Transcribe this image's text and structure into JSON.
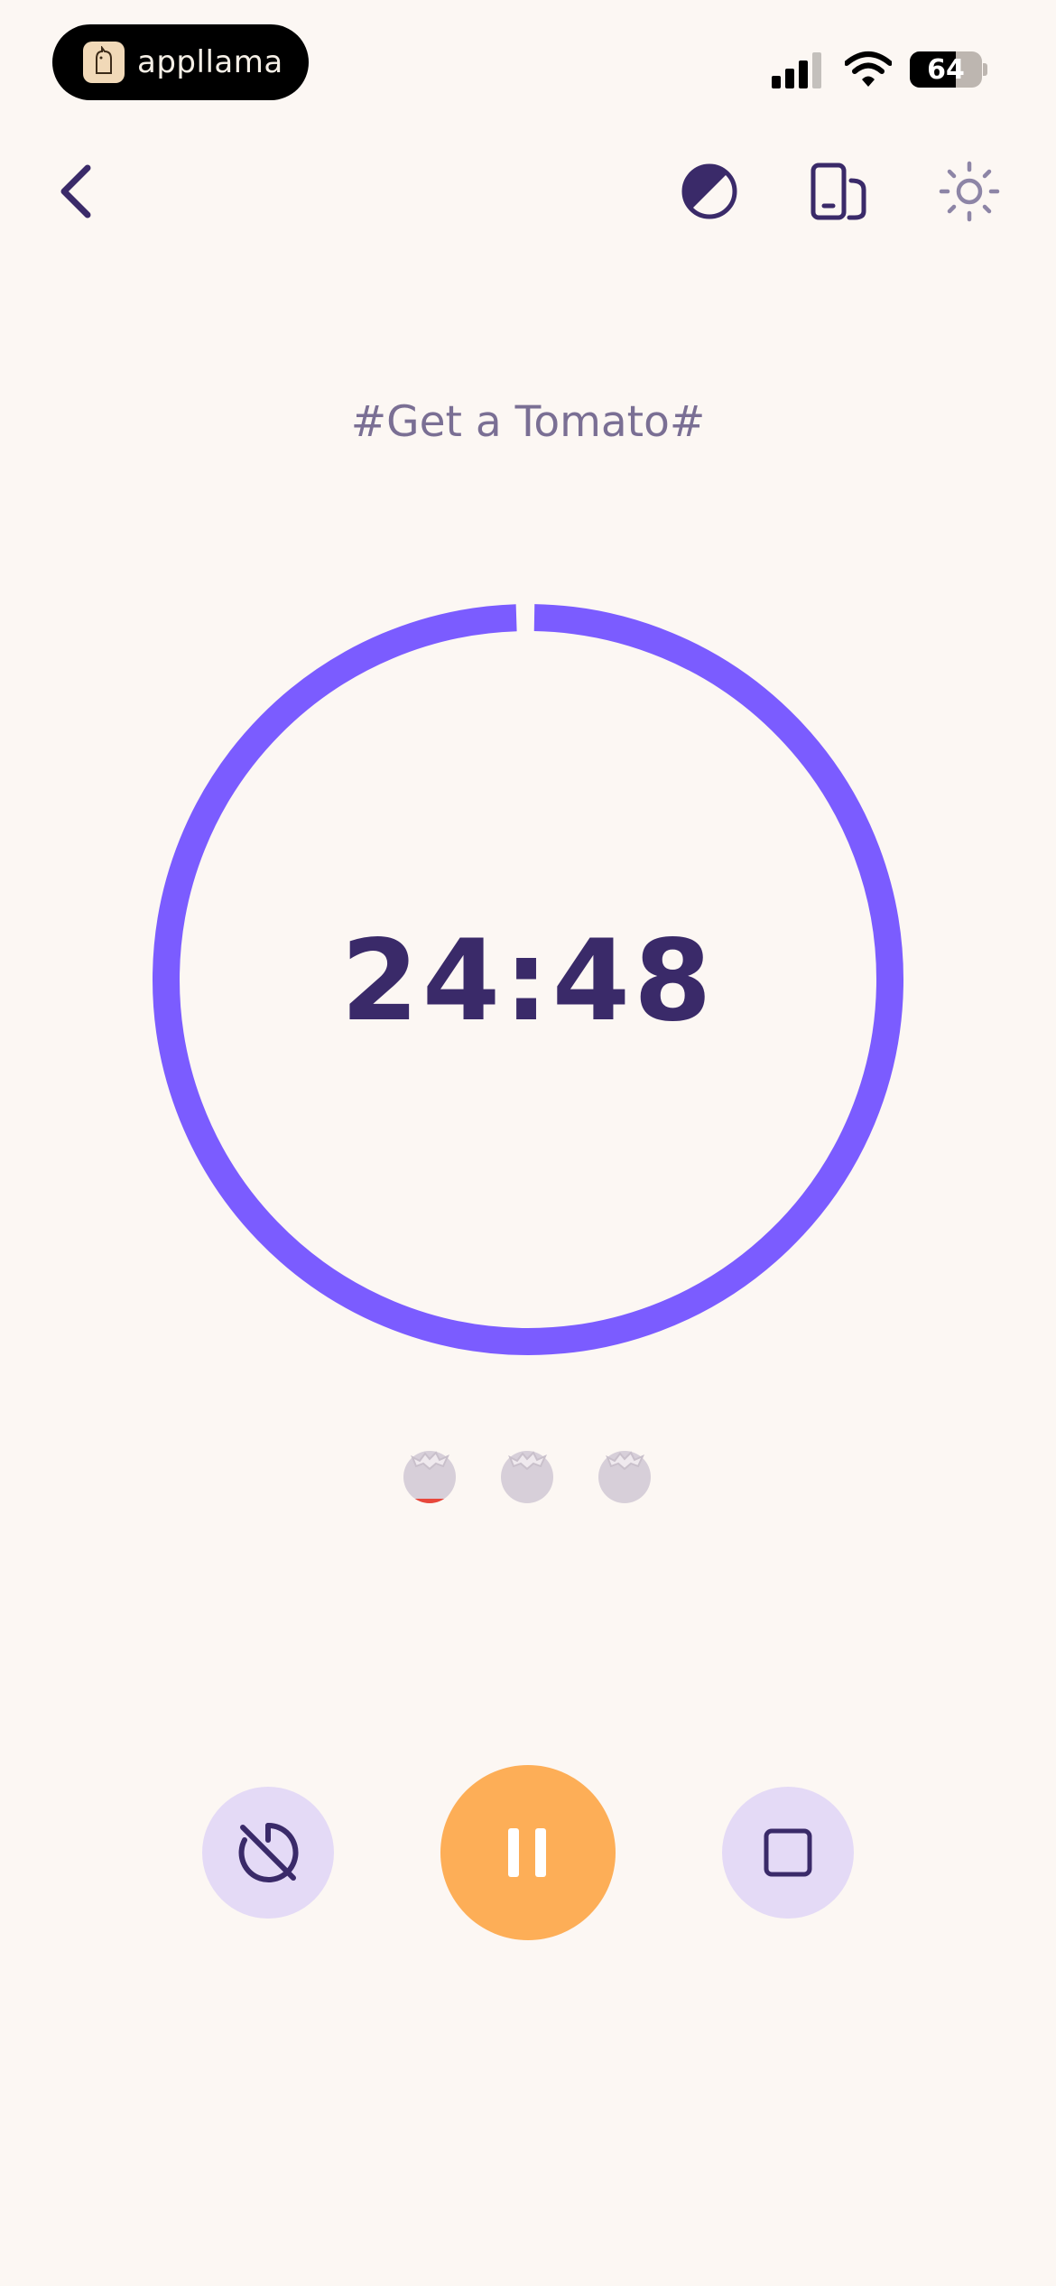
{
  "status_bar": {
    "brand": "appllama",
    "battery_percent": "64",
    "battery_level": 0.64
  },
  "nav": {
    "back_icon": "chevron-left-icon",
    "theme_icon": "contrast-icon",
    "device_icon": "devices-icon",
    "brightness_icon": "sun-icon"
  },
  "session": {
    "title": "#Get a Tomato#",
    "time_remaining": "24:48",
    "progress": 0.992
  },
  "tomatoes": {
    "total": 3,
    "active_index": 0
  },
  "controls": {
    "left_icon": "timer-off-icon",
    "center_icon": "pause-icon",
    "right_icon": "stop-icon"
  },
  "colors": {
    "background": "#fcf7f3",
    "accent_ring": "#7b5cff",
    "primary_button": "#fdae57",
    "secondary_button": "#e4daf6",
    "text_dark": "#3a2a69",
    "text_muted": "#7a6f94"
  }
}
